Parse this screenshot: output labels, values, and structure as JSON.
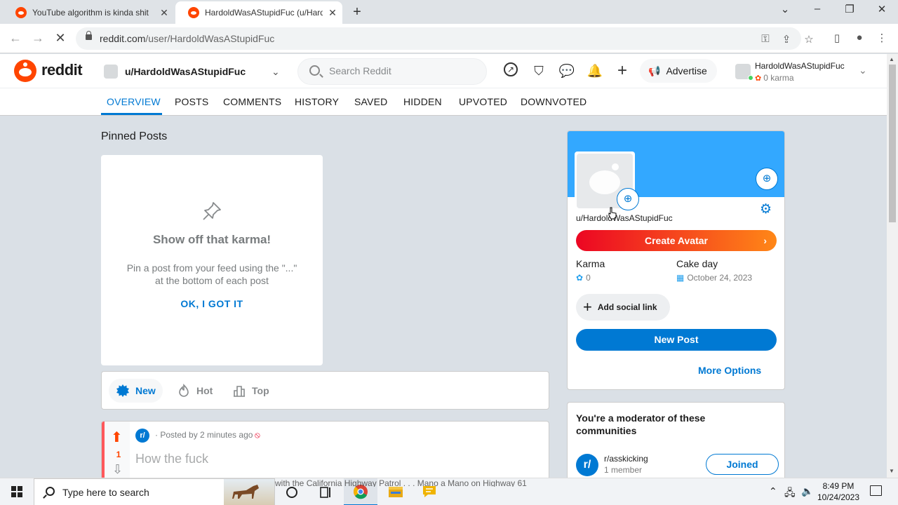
{
  "browser": {
    "tabs": [
      {
        "title": "YouTube algorithm is kinda shit",
        "active": false
      },
      {
        "title": "HardoldWasAStupidFuc (u/Hardo",
        "active": true
      }
    ],
    "url_domain": "reddit.com",
    "url_path": "/user/HardoldWasAStupidFuc"
  },
  "header": {
    "wordmark": "reddit",
    "user_dropdown": "u/HardoldWasAStupidFuc",
    "search_placeholder": "Search Reddit",
    "advertise": "Advertise",
    "account_name": "HardoldWasAStupidFuc",
    "account_karma": "0 karma"
  },
  "profile_tabs": [
    "OVERVIEW",
    "POSTS",
    "COMMENTS",
    "HISTORY",
    "SAVED",
    "HIDDEN",
    "UPVOTED",
    "DOWNVOTED"
  ],
  "pinned": {
    "section_title": "Pinned Posts",
    "heading": "Show off that karma!",
    "text": "Pin a post from your feed using the \"...\" at the bottom of each post",
    "ok": "OK, I GOT IT"
  },
  "sort": {
    "new": "New",
    "hot": "Hot",
    "top": "Top"
  },
  "post": {
    "subreddit_icon": "r/",
    "meta": "· Posted by 2 minutes ago",
    "score": "1",
    "title": "How the fuck"
  },
  "profile_card": {
    "username": "u/HardoldWasAStupidFuc",
    "create_avatar": "Create Avatar",
    "karma_label": "Karma",
    "karma_value": "0",
    "cakeday_label": "Cake day",
    "cakeday_value": "October 24, 2023",
    "add_social": "Add social link",
    "new_post": "New Post",
    "more_options": "More Options"
  },
  "mod_card": {
    "title": "You're a moderator of these communities",
    "community_name": "r/asskicking",
    "community_members": "1 member",
    "joined": "Joined",
    "icon": "r/"
  },
  "taskbar": {
    "search_placeholder": "Type here to search",
    "ticker": "with the California Highway Patrol . . . Mano a Mano on Highway 61",
    "time": "8:49 PM",
    "date": "10/24/2023"
  },
  "colors": {
    "reddit_orange": "#ff4500",
    "reddit_blue": "#0079d3",
    "banner_blue": "#33a8ff"
  }
}
